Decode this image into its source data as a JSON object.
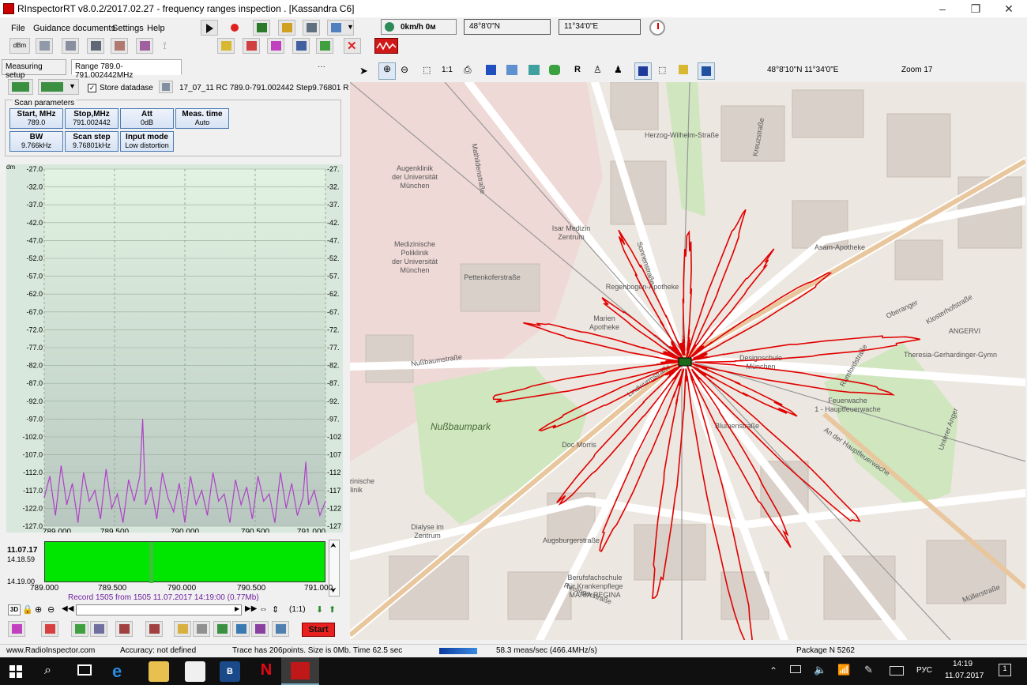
{
  "window": {
    "title": "RInspectorRT v8.0.2/2017.02.27 - frequency ranges inspection . [Kassandra C6]",
    "controls": [
      "–",
      "❐",
      "✕"
    ]
  },
  "menu": [
    "File",
    "Guidance documents",
    "Settings",
    "Help"
  ],
  "toolbar": {
    "dbm_label": "dBm",
    "speed": "0km/h 0м",
    "lat": "48°8'0\"N",
    "lon": "11°34'0\"E"
  },
  "tabs": [
    "Measuring setup",
    "Range 789.0-791.002442MHz"
  ],
  "store": {
    "checkbox_label": "Store datadase",
    "checked": true,
    "file_name": "17_07_11 RC 789.0-791.002442 Step9.76801 R"
  },
  "scan_parameters": {
    "heading": "Scan parameters",
    "buttons": [
      {
        "label": "Start, MHz",
        "value": "789.0"
      },
      {
        "label": "Stop,MHz",
        "value": "791.002442"
      },
      {
        "label": "Att",
        "value": "0dB"
      },
      {
        "label": "Meas. time",
        "value": "Auto"
      },
      {
        "label": "BW",
        "value": "9.766kHz"
      },
      {
        "label": "Scan step",
        "value": "9.76801kHz"
      },
      {
        "label": "Input mode",
        "value": "Low distortion"
      }
    ]
  },
  "spectrum": {
    "unit": "dm",
    "y_ticks": [
      "-27.0",
      "-32.0",
      "-37.0",
      "-42.0",
      "-47.0",
      "-52.0",
      "-57.0",
      "-62.0",
      "-67.0",
      "-72.0",
      "-77.0",
      "-82.0",
      "-87.0",
      "-92.0",
      "-97.0",
      "-102.0",
      "-107.0",
      "-112.0",
      "-117.0",
      "-122.0",
      "-127.0"
    ],
    "y_ticks_right": [
      "-27.",
      "-32.",
      "-37.",
      "-42.",
      "-47.",
      "-52.",
      "-57.",
      "-62.",
      "-67.",
      "-72.",
      "-77.",
      "-82.",
      "-87.",
      "-92.",
      "-97.",
      "-102",
      "-107",
      "-112",
      "-117",
      "-122",
      "-127"
    ],
    "x_ticks": [
      "789.000",
      "789.500",
      "790.000",
      "790.500",
      "791.000"
    ],
    "trace_color": "#b040c8"
  },
  "chart_data": {
    "type": "line",
    "xlabel": "",
    "ylabel": "dm",
    "xlim": [
      789.0,
      791.0
    ],
    "ylim": [
      -127.0,
      -27.0
    ],
    "grid": true,
    "x": [
      789.0,
      789.04,
      789.08,
      789.12,
      789.16,
      789.2,
      789.24,
      789.28,
      789.32,
      789.36,
      789.4,
      789.44,
      789.48,
      789.52,
      789.56,
      789.6,
      789.64,
      789.68,
      789.7,
      789.72,
      789.76,
      789.8,
      789.84,
      789.88,
      789.92,
      789.96,
      790.0,
      790.04,
      790.08,
      790.12,
      790.16,
      790.2,
      790.24,
      790.28,
      790.32,
      790.36,
      790.4,
      790.44,
      790.48,
      790.52,
      790.56,
      790.6,
      790.64,
      790.68,
      790.72,
      790.76,
      790.8,
      790.84,
      790.86,
      790.88,
      790.92,
      790.96,
      791.0
    ],
    "series": [
      {
        "values": [
          -119,
          -113,
          -124,
          -110,
          -121,
          -115,
          -126,
          -112,
          -120,
          -117,
          -125,
          -111,
          -122,
          -118,
          -126,
          -114,
          -120,
          -113,
          -97,
          -121,
          -116,
          -125,
          -112,
          -119,
          -123,
          -115,
          -126,
          -113,
          -121,
          -117,
          -124,
          -112,
          -120,
          -118,
          -126,
          -114,
          -121,
          -116,
          -125,
          -113,
          -120,
          -118,
          -126,
          -112,
          -122,
          -115,
          -124,
          -119,
          -109,
          -121,
          -117,
          -124,
          -120
        ]
      }
    ]
  },
  "waterfall": {
    "date": "11.07.17",
    "time_top": "14.18.59",
    "time_bottom": "14.19.00",
    "x_ticks": [
      "789.000",
      "789.500",
      "790.000",
      "790.500",
      "791.000"
    ],
    "record_info": "Record 1505  from 1505   11.07.2017  14:19:00  (0.77Mb)"
  },
  "nav": {
    "mode_3d": "3D",
    "zoom_ratio": "(1:1)"
  },
  "start_button": "Start",
  "map": {
    "coords": "48°8'10\"N 11°34'0\"E",
    "zoom": "Zoom 17",
    "labels": [
      {
        "text": "Augenklinik\nder Universität\nMünchen"
      },
      {
        "text": "Isar Medizin\nZentrum"
      },
      {
        "text": "Medizinische\nPoliklinik\nder Universität\nMünchen"
      },
      {
        "text": "Nußbaumstraße"
      },
      {
        "text": "Nußbaumpark"
      },
      {
        "text": "Pettenkoferstraße"
      },
      {
        "text": "Sonnenstraße"
      },
      {
        "text": "Lindwurmstraße"
      },
      {
        "text": "Asam-Apotheke"
      },
      {
        "text": "ANGERVI"
      },
      {
        "text": "Theresia-Gerhardinger-Gymn"
      },
      {
        "text": "Feuerwache\n1 - Hauptfeuerwache"
      },
      {
        "text": "Blumenstraße"
      },
      {
        "text": "Dialyse im\nZentrum"
      },
      {
        "text": "Berufsfachschule\nfür Krankenpflege\nMARIA REGINA"
      },
      {
        "text": "Augsburgerstraße"
      },
      {
        "text": "Oberanger"
      },
      {
        "text": "Unterer Anger"
      },
      {
        "text": "Klosterhofstraße"
      },
      {
        "text": "Regenbogen-Apotheke"
      },
      {
        "text": "Designschule\nMünchen"
      },
      {
        "text": "Marien\nApotheke"
      },
      {
        "text": "Doc Morris"
      },
      {
        "text": "Herzog-Wilhelm-Straße"
      },
      {
        "text": "Kreuzstraße"
      },
      {
        "text": "Mathildenstraße"
      },
      {
        "text": "Rumfordstraße"
      },
      {
        "text": "An der Hauptfeuerwache"
      },
      {
        "text": "Reisingerstraße"
      },
      {
        "text": "Müllerstraße"
      },
      {
        "text": "Medizinische\nKlinik"
      }
    ],
    "pattern_color": "#e00000"
  },
  "status": {
    "url": "www.RadioInspector.com",
    "accuracy": "Accuracy: not defined",
    "trace": "Trace has 206points. Size is 0Mb. Time 62.5 sec",
    "rate": "58.3 meas/sec   (466.4MHz/s)",
    "package": "Package N 5262"
  },
  "taskbar": {
    "time": "14:19",
    "date": "11.07.2017",
    "lang": "РУС"
  }
}
